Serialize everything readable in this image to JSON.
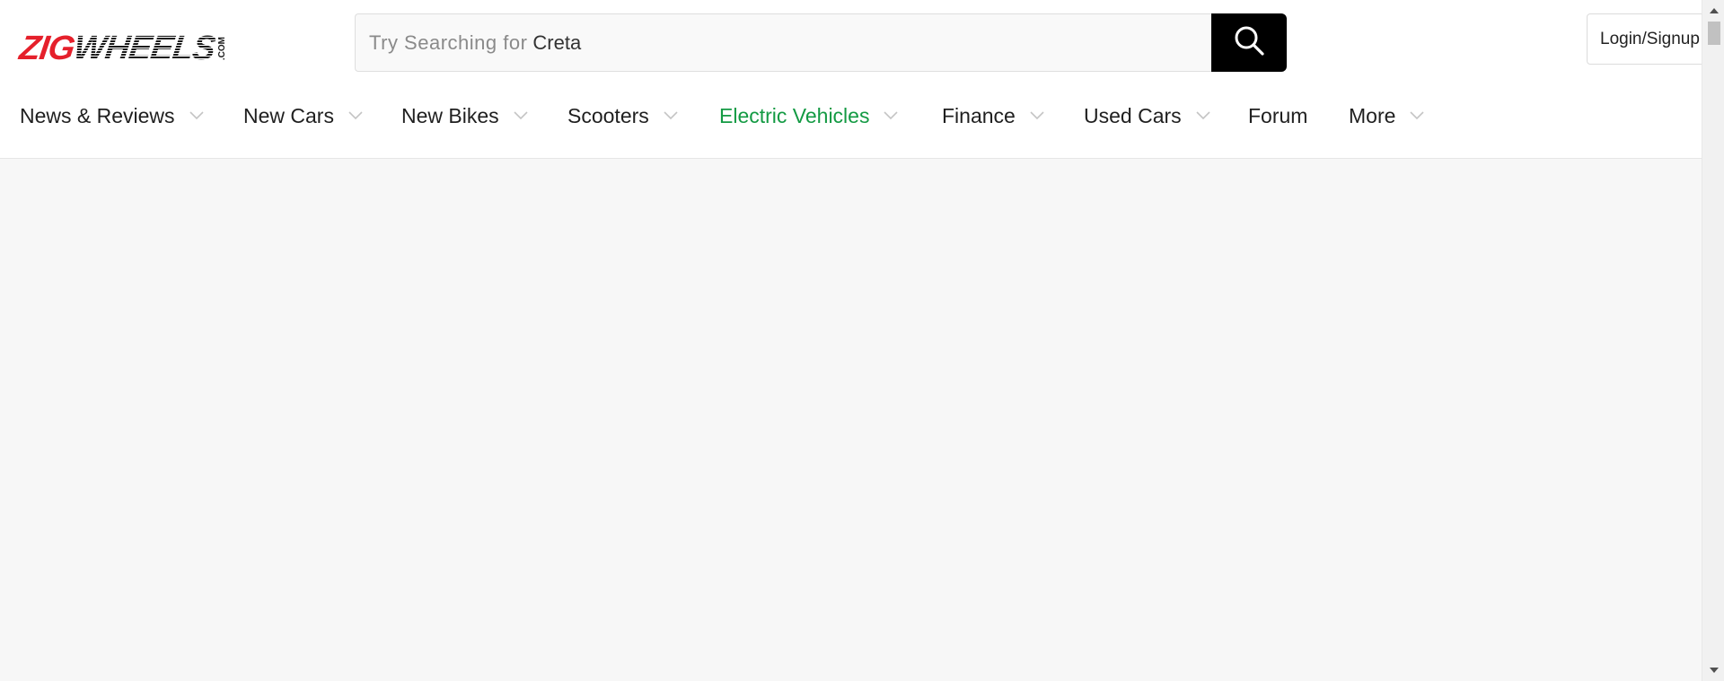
{
  "logo": {
    "zig": "ZIG",
    "wheels": "WHEELS",
    "com": ".COM"
  },
  "search": {
    "prefix": "Try Searching for",
    "term": "Creta"
  },
  "login": {
    "label": "Login/Signup"
  },
  "nav": [
    {
      "label": "News & Reviews",
      "dropdown": true
    },
    {
      "label": "New Cars",
      "dropdown": true
    },
    {
      "label": "New Bikes",
      "dropdown": true
    },
    {
      "label": "Scooters",
      "dropdown": true
    },
    {
      "label": "Electric Vehicles",
      "dropdown": true,
      "active": true
    },
    {
      "label": "Finance",
      "dropdown": true
    },
    {
      "label": "Used Cars",
      "dropdown": true
    },
    {
      "label": "Forum",
      "dropdown": false
    },
    {
      "label": "More",
      "dropdown": true
    }
  ],
  "colors": {
    "brand_red": "#e5202b",
    "active_green": "#139a43",
    "search_button": "#000000"
  }
}
